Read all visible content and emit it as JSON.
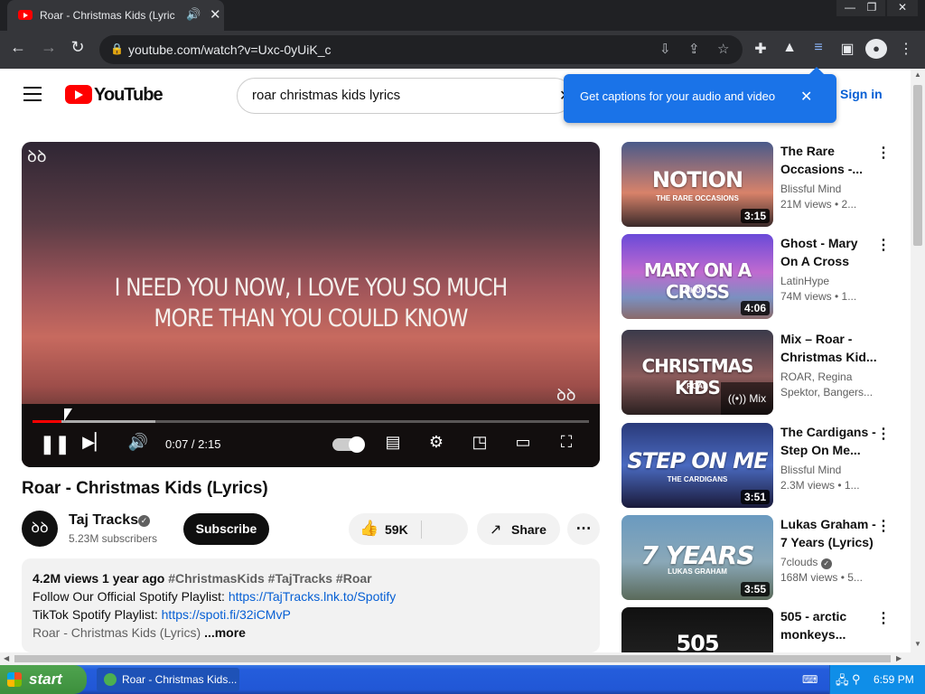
{
  "browser": {
    "tab_title": "Roar - Christmas Kids (Lyrics) -",
    "url": "youtube.com/watch?v=Uxc-0yUiK_c"
  },
  "youtube": {
    "logo_text": "YouTube",
    "search_value": "roar christmas kids lyrics",
    "signin_label": "Sign in",
    "tooltip_text": "Get captions for your audio and video"
  },
  "player": {
    "lyric_line1": "I NEED YOU NOW, I LOVE YOU SO MUCH",
    "lyric_line2": "MORE THAN YOU COULD KNOW",
    "time": "0:07 / 2:15",
    "progress_fraction": 0.052,
    "buffered_fraction": 0.22
  },
  "video": {
    "title": "Roar - Christmas Kids (Lyrics)",
    "channel": "Taj Tracks",
    "subscribers": "5.23M subscribers",
    "subscribe_label": "Subscribe",
    "likes": "59K",
    "share_label": "Share",
    "description": {
      "stats": "4.2M views  1 year ago",
      "tags": "#ChristmasKids #TajTracks #Roar",
      "line2_prefix": "Follow Our Official Spotify Playlist: ",
      "line2_link": "https://TajTracks.lnk.to/Spotify",
      "line3_prefix": "TikTok Spotify Playlist: ",
      "line3_link": "https://spoti.fi/32iCMvP",
      "line4": "Roar - Christmas Kids (Lyrics)",
      "more": "...more"
    }
  },
  "recommendations": [
    {
      "title": "The Rare Occasions -...",
      "channel": "Blissful Mind",
      "meta": "21M views  • 2...",
      "duration": "3:15",
      "thumb_text": "NOTION",
      "thumb_sub": "THE RARE OCCASIONS"
    },
    {
      "title": "Ghost - Mary On A Cross",
      "channel": "LatinHype",
      "meta": "74M views  • 1...",
      "duration": "4:06",
      "thumb_text": "MARY ON A CROSS",
      "thumb_sub": "GHOST"
    },
    {
      "title": "Mix – Roar - Christmas Kid...",
      "channel": "ROAR, Regina Spektor, Bangers...",
      "meta": "",
      "duration": "",
      "badge": "Mix",
      "thumb_text": "CHRISTMAS KIDS",
      "thumb_sub": "ROAR"
    },
    {
      "title": "The Cardigans - Step On Me...",
      "channel": "Blissful Mind",
      "meta": "2.3M views  • 1...",
      "duration": "3:51",
      "thumb_text": "STEP ON ME",
      "thumb_sub": "THE CARDIGANS"
    },
    {
      "title": "Lukas Graham - 7 Years (Lyrics)",
      "channel": "7clouds",
      "meta": "168M views  • 5...",
      "duration": "3:55",
      "thumb_text": "7 YEARS",
      "thumb_sub": "LUKAS GRAHAM"
    },
    {
      "title": "505 - arctic monkeys...",
      "channel": "",
      "meta": "",
      "duration": "",
      "thumb_text": "505",
      "thumb_sub": ""
    }
  ],
  "taskbar": {
    "start_label": "start",
    "task_label": "Roar - Christmas Kids...",
    "clock": "6:59 PM"
  },
  "colors": {
    "youtube_red": "#ff0000",
    "link_blue": "#065fd4",
    "tooltip_blue": "#1a73e8",
    "chrome_dark": "#35363a",
    "xp_start_green": "#3c8f3c",
    "xp_taskbar_blue": "#245ddc"
  }
}
